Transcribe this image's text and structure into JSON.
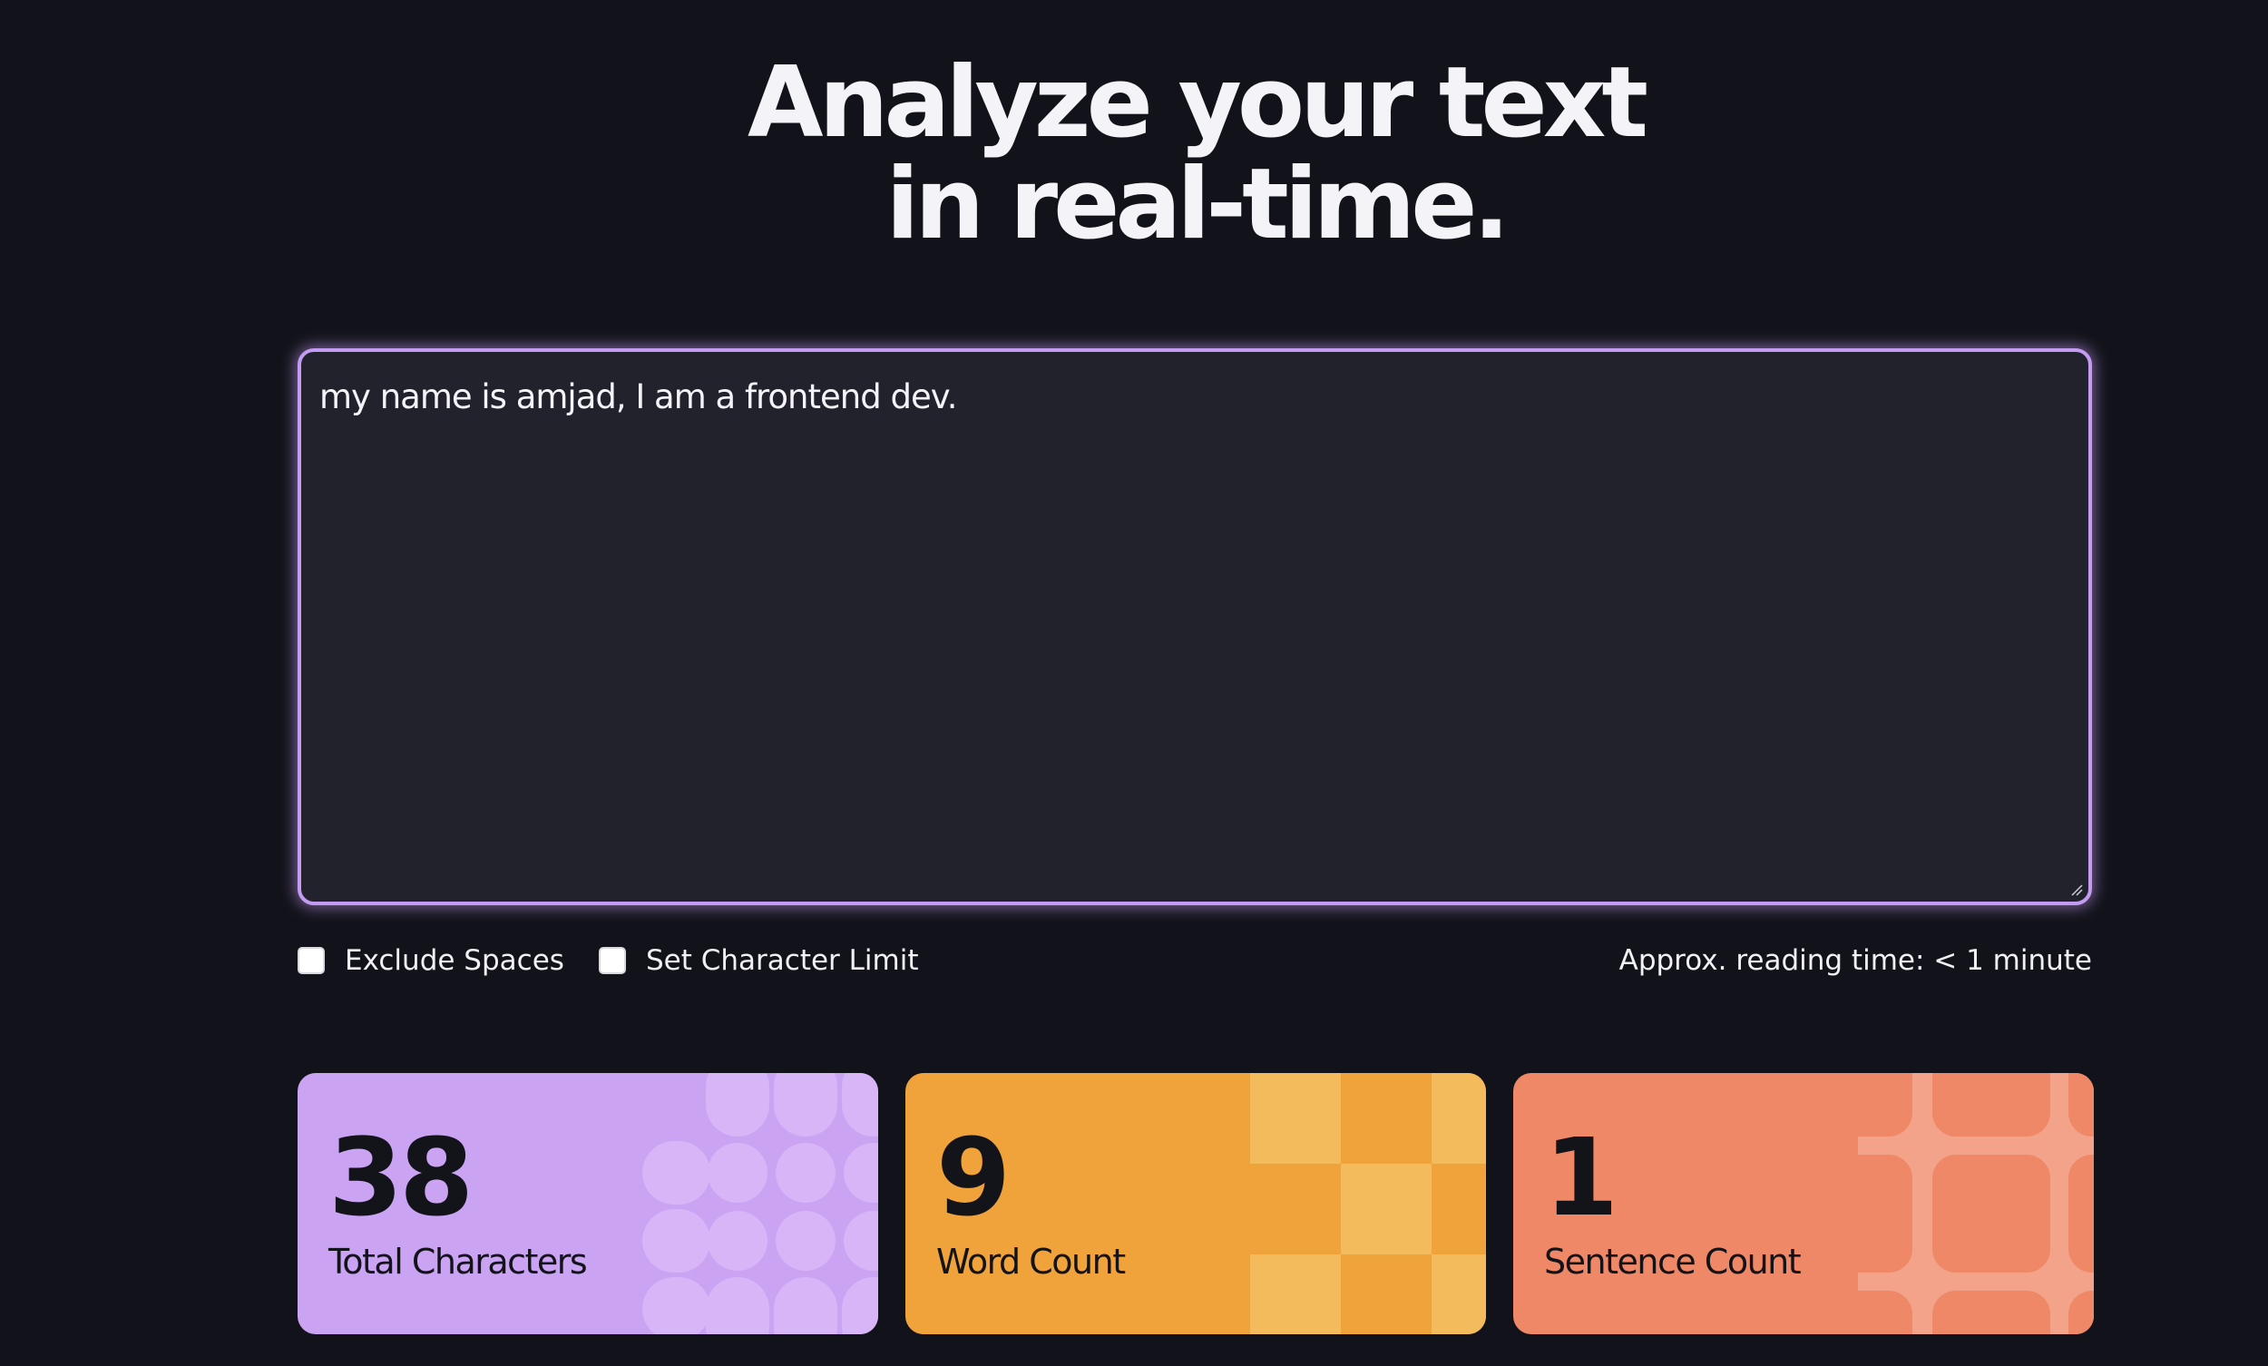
{
  "header": {
    "title_line1": "Analyze your text",
    "title_line2": "in real-time."
  },
  "editor": {
    "value": "my name is amjad, I am a frontend dev."
  },
  "options": {
    "exclude_spaces_label": "Exclude Spaces",
    "exclude_spaces_checked": false,
    "char_limit_label": "Set Character Limit",
    "char_limit_checked": false,
    "reading_time": "Approx. reading time: < 1 minute"
  },
  "stats": [
    {
      "value": "38",
      "label": "Total Characters",
      "color": "#cba3f3"
    },
    {
      "value": "9",
      "label": "Word Count",
      "color": "#f1a33b"
    },
    {
      "value": "1",
      "label": "Sentence Count",
      "color": "#ef8866"
    }
  ],
  "colors": {
    "background": "#12131a",
    "editor_bg": "#21222c",
    "accent": "#c49bf2"
  }
}
